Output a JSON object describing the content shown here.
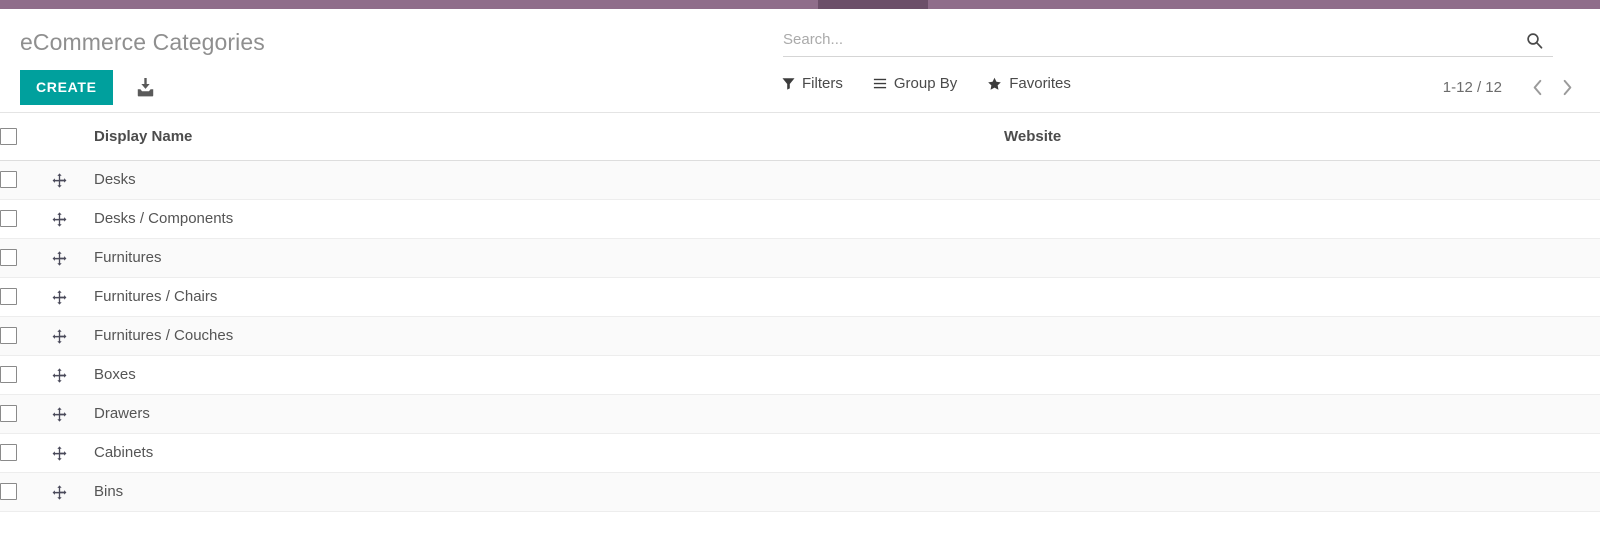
{
  "navbar": {
    "color": "#8f6d8a",
    "active_segment_color": "#6c4f69"
  },
  "control_panel": {
    "breadcrumb": "eCommerce Categories",
    "create_label": "CREATE",
    "create_color": "#00a09d",
    "import_icon": "import-download-icon",
    "search": {
      "placeholder": "Search...",
      "value": "",
      "icon": "search-icon"
    },
    "filter_menus": [
      {
        "label": "Filters",
        "icon": "filter-funnel-icon"
      },
      {
        "label": "Group By",
        "icon": "bars-list-icon"
      },
      {
        "label": "Favorites",
        "icon": "star-icon"
      }
    ],
    "pager": {
      "value": "1-12 / 12",
      "prev_icon": "chevron-left-icon",
      "next_icon": "chevron-right-icon"
    }
  },
  "list": {
    "columns": [
      {
        "key": "display_name",
        "label": "Display Name"
      },
      {
        "key": "website",
        "label": "Website"
      }
    ],
    "select_all_icon": "checkbox-unchecked-icon",
    "row_handle_icon": "drag-move-icon",
    "rows": [
      {
        "display_name": "Desks",
        "website": ""
      },
      {
        "display_name": "Desks / Components",
        "website": ""
      },
      {
        "display_name": "Furnitures",
        "website": ""
      },
      {
        "display_name": "Furnitures / Chairs",
        "website": ""
      },
      {
        "display_name": "Furnitures / Couches",
        "website": ""
      },
      {
        "display_name": "Boxes",
        "website": ""
      },
      {
        "display_name": "Drawers",
        "website": ""
      },
      {
        "display_name": "Cabinets",
        "website": ""
      },
      {
        "display_name": "Bins",
        "website": ""
      }
    ]
  }
}
